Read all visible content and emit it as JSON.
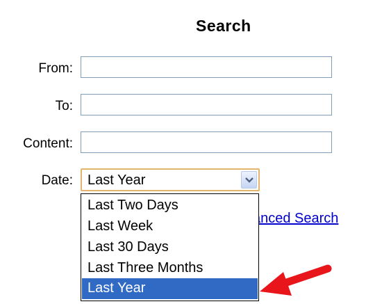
{
  "form": {
    "title": "Search",
    "labels": {
      "from": "From:",
      "to": "To:",
      "content": "Content:",
      "date": "Date:"
    },
    "values": {
      "from": "",
      "to": "",
      "content": ""
    },
    "date_select": {
      "selected": "Last Year",
      "options": [
        "Last Two Days",
        "Last Week",
        "Last 30 Days",
        "Last Three Months",
        "Last Year"
      ],
      "highlighted_index": 4
    },
    "advanced_search_link": "anced Search"
  },
  "colors": {
    "selected_option_bg": "#316ac5",
    "link": "#0000cc",
    "arrow": "#e8151b",
    "focused_select_border": "#e3b56a"
  },
  "icons": {
    "dropdown": "chevron-down-icon",
    "pointer": "red-arrow-icon"
  }
}
